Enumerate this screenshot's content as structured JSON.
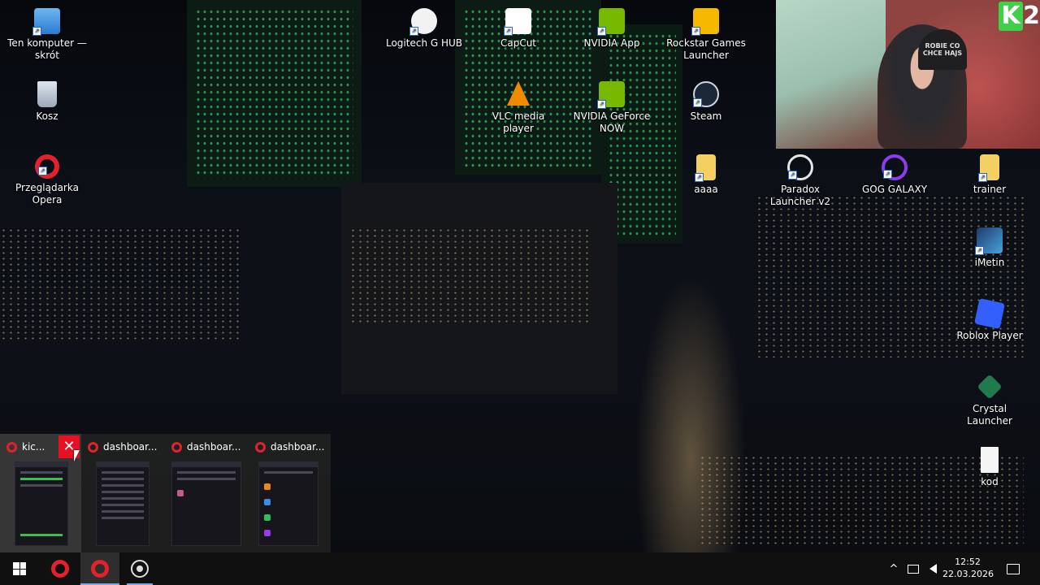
{
  "desktop_icons": [
    {
      "label": "Ten komputer — skrót",
      "icon": "computer-icon"
    },
    {
      "label": "Kosz",
      "icon": "recycle-bin-icon"
    },
    {
      "label": "Przeglądarka Opera",
      "icon": "opera-icon"
    },
    {
      "label": "Logitech G HUB",
      "icon": "logitech-icon"
    },
    {
      "label": "CapCut",
      "icon": "capcut-icon"
    },
    {
      "label": "NVIDIA App",
      "icon": "nvidia-icon"
    },
    {
      "label": "Rockstar Games Launcher",
      "icon": "rockstar-icon"
    },
    {
      "label": "VLC media player",
      "icon": "vlc-icon"
    },
    {
      "label": "NVIDIA GeForce NOW",
      "icon": "nvidia-icon"
    },
    {
      "label": "Steam",
      "icon": "steam-icon"
    },
    {
      "label": "aaaa",
      "icon": "folder-icon"
    },
    {
      "label": "Paradox Launcher v2",
      "icon": "paradox-icon"
    },
    {
      "label": "GOG GALAXY",
      "icon": "gog-icon"
    },
    {
      "label": "trainer",
      "icon": "folder-icon"
    },
    {
      "label": "iMetin",
      "icon": "app-icon"
    },
    {
      "label": "Roblox Player",
      "icon": "roblox-icon"
    },
    {
      "label": "Crystal Launcher",
      "icon": "crystal-icon"
    },
    {
      "label": "kod",
      "icon": "text-file-icon"
    }
  ],
  "webcam": {
    "cap_text": "ROBIE CO CHCE HAJS",
    "logo_letter": "K",
    "logo_number": "2"
  },
  "taskbar_thumbnails": [
    {
      "title": "kic...",
      "close_label": "✕"
    },
    {
      "title": "dashboar..."
    },
    {
      "title": "dashboar..."
    },
    {
      "title": "dashboar..."
    }
  ],
  "taskbar": {
    "time": "12:52",
    "date": "22.03.2026",
    "tray_chevron": "^",
    "colors": {
      "taskbar": "#101010",
      "accent": "#7aa8e8",
      "close": "#e81123",
      "opera": "#e0222b"
    }
  }
}
